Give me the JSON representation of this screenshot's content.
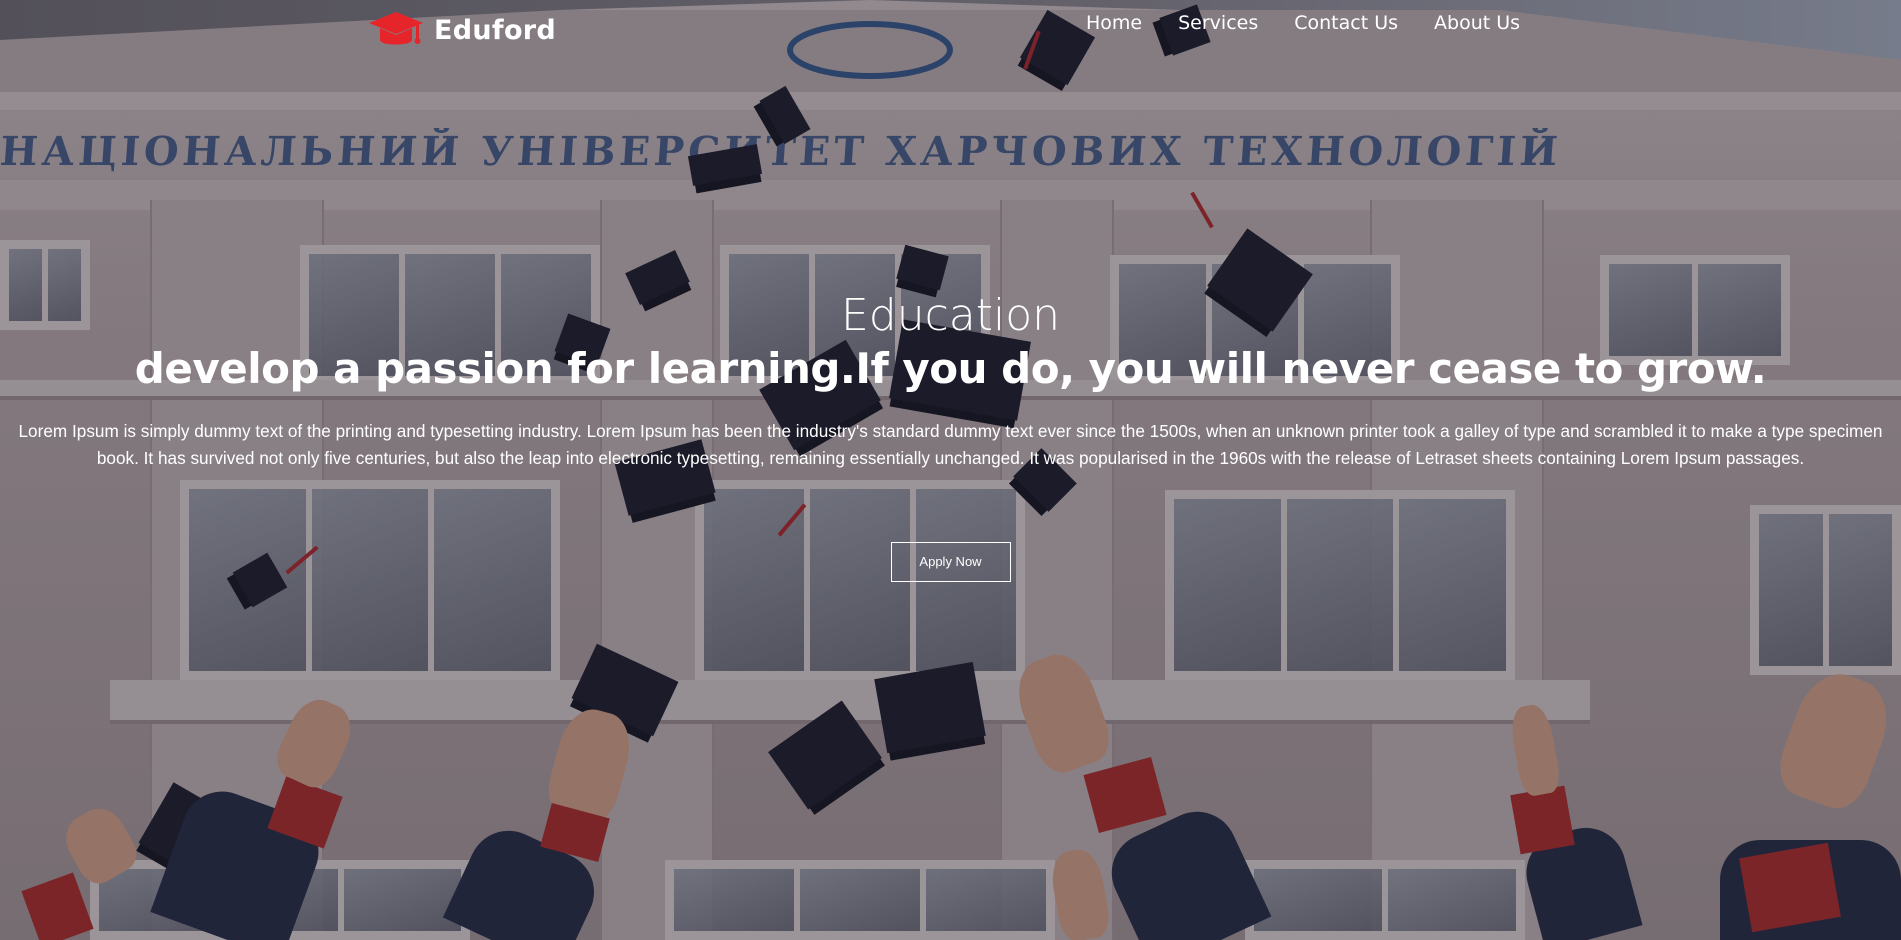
{
  "brand": {
    "name": "Eduford",
    "icon": "graduation-cap-icon",
    "icon_color": "#e5252a"
  },
  "nav": {
    "items": [
      {
        "label": "Home"
      },
      {
        "label": "Services"
      },
      {
        "label": "Contact Us"
      },
      {
        "label": "About Us"
      }
    ]
  },
  "hero": {
    "title": "Education",
    "subtitle": "develop a passion for learning.If you do, you will never cease to grow.",
    "description": "Lorem Ipsum is simply dummy text of the printing and typesetting industry. Lorem Ipsum has been the industry's standard dummy text ever since the 1500s, when an unknown printer took a galley of type and scrambled it to make a type specimen book. It has survived not only five centuries, but also the leap into electronic typesetting, remaining essentially unchanged. It was popularised in the 1960s with the release of Letraset sheets containing Lorem Ipsum passages.",
    "cta_label": "Apply Now",
    "background_image": "university-building-graduation-caps-photo",
    "facade_inscription": "НАЦІОНАЛЬНИЙ УНІВЕРСИТЕТ ХАРЧОВИХ ТЕХНОЛОГІЙ"
  },
  "colors": {
    "text": "#ffffff",
    "accent": "#e5252a",
    "overlay": "rgba(40,30,40,0.38)"
  }
}
